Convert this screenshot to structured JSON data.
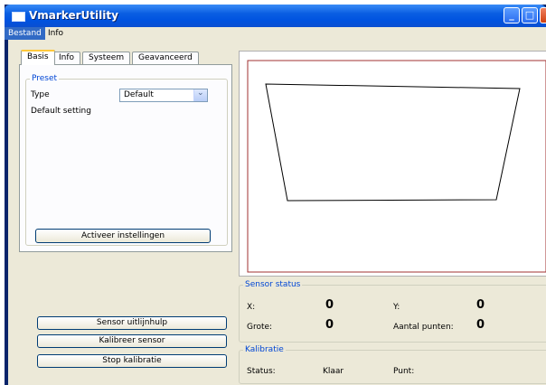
{
  "window": {
    "title": "VmarkerUtility",
    "controls": [
      "minimize-icon",
      "maximize-icon",
      "close-icon"
    ]
  },
  "menu": {
    "items": [
      "Bestand",
      "Info"
    ]
  },
  "tabs": [
    "Basis",
    "Info",
    "Systeem",
    "Geavanceerd"
  ],
  "preset": {
    "group_label": "Preset",
    "type_label": "Type",
    "type_value": "Default",
    "description": "Default setting",
    "activate_button": "Activeer instellingen"
  },
  "left_buttons": {
    "sensor_align": "Sensor uitlijnhulp",
    "calibrate": "Kalibreer sensor",
    "stop": "Stop kalibratie"
  },
  "sensor_status": {
    "group_label": "Sensor status",
    "x_label": "X:",
    "x_value": "0",
    "y_label": "Y:",
    "y_value": "0",
    "size_label": "Grote:",
    "size_value": "0",
    "points_label": "Aantal punten:",
    "points_value": "0"
  },
  "calibration": {
    "group_label": "Kalibratie",
    "status_label": "Status:",
    "status_value": "Klaar",
    "point_label": "Punt:",
    "point_value": ""
  },
  "colors": {
    "title_bar": "#0a5ee2",
    "group_label": "#0046d5",
    "canvas_border": "#a03030",
    "window_bg": "#ece9d8"
  }
}
